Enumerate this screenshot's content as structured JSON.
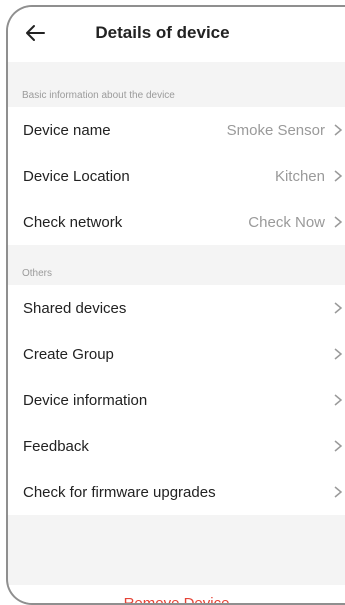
{
  "header": {
    "title": "Details of device"
  },
  "sections": [
    {
      "label": "Basic information about the device",
      "items": [
        {
          "label": "Device name",
          "value": "Smoke Sensor"
        },
        {
          "label": "Device Location",
          "value": "Kitchen"
        },
        {
          "label": "Check network",
          "value": "Check Now"
        }
      ]
    },
    {
      "label": "Others",
      "items": [
        {
          "label": "Shared devices"
        },
        {
          "label": "Create Group"
        },
        {
          "label": "Device information"
        },
        {
          "label": "Feedback"
        },
        {
          "label": "Check for firmware upgrades"
        }
      ]
    }
  ],
  "footer": {
    "remove_label": "Remove Device"
  },
  "colors": {
    "danger": "#e54336",
    "muted": "#9a9a9a",
    "background": "#f4f4f4"
  }
}
